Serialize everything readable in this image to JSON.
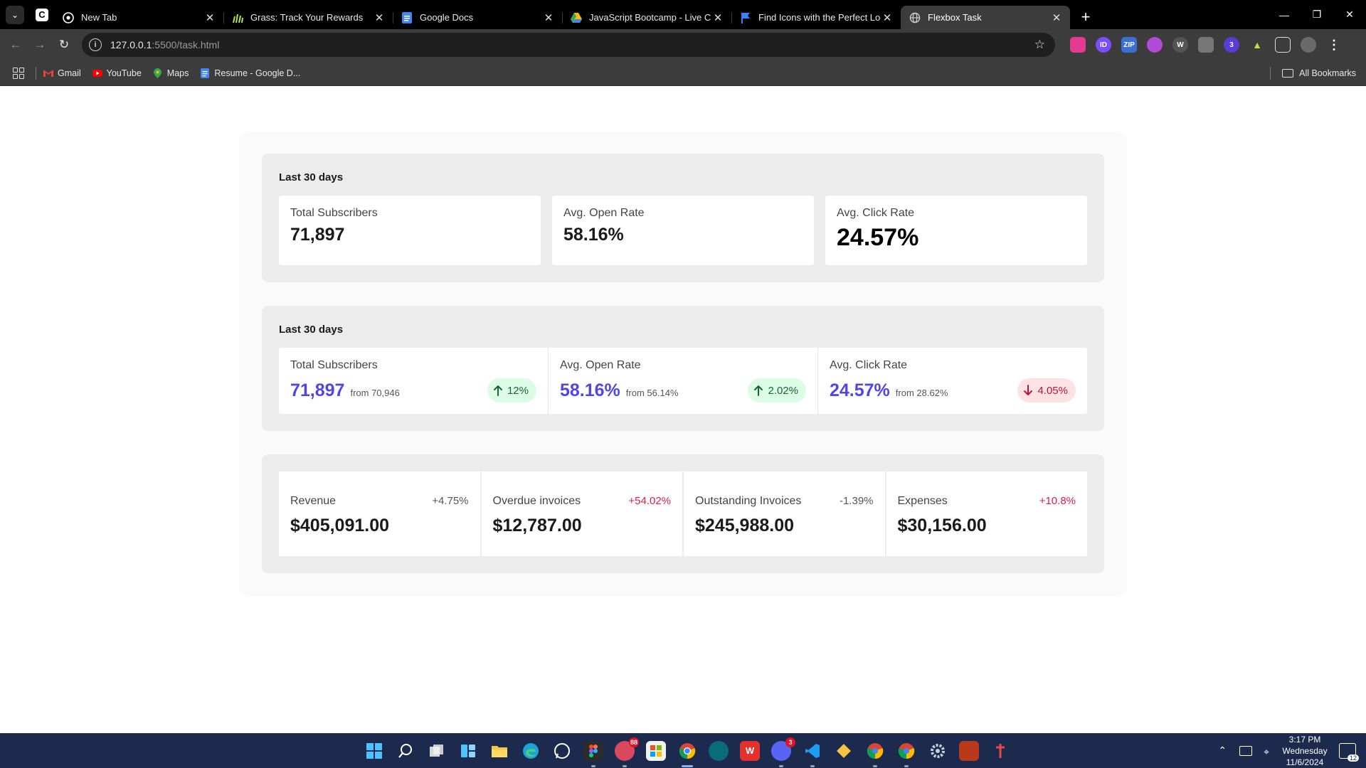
{
  "browser": {
    "tabs": [
      {
        "title": "New Tab",
        "icon": "chrome-icon",
        "active": false
      },
      {
        "title": "Grass: Track Your Rewards",
        "icon": "grass-icon",
        "active": false
      },
      {
        "title": "Google Docs",
        "icon": "google-docs-icon",
        "active": false
      },
      {
        "title": "JavaScript Bootcamp - Live Clas",
        "icon": "google-drive-icon",
        "active": false
      },
      {
        "title": "Find Icons with the Perfect Look",
        "icon": "flag-icon",
        "active": false
      },
      {
        "title": "Flexbox Task",
        "icon": "globe-icon",
        "active": true
      }
    ],
    "url_host": "127.0.0.1",
    "url_rest": ":5500/task.html",
    "bookmarks": [
      {
        "label": "Gmail",
        "icon": "gmail-icon"
      },
      {
        "label": "YouTube",
        "icon": "youtube-icon"
      },
      {
        "label": "Maps",
        "icon": "maps-icon"
      },
      {
        "label": "Resume - Google D...",
        "icon": "google-docs-icon"
      }
    ],
    "all_bookmarks": "All Bookmarks"
  },
  "section1": {
    "title": "Last 30 days",
    "cards": [
      {
        "label": "Total Subscribers",
        "value": "71,897"
      },
      {
        "label": "Avg. Open Rate",
        "value": "58.16%"
      },
      {
        "label": "Avg. Click Rate",
        "value": "24.57%"
      }
    ]
  },
  "section2": {
    "title": "Last 30 days",
    "cards": [
      {
        "label": "Total Subscribers",
        "value": "71,897",
        "from": "from 70,946",
        "change": "12%",
        "direction": "up"
      },
      {
        "label": "Avg. Open Rate",
        "value": "58.16%",
        "from": "from 56.14%",
        "change": "2.02%",
        "direction": "up"
      },
      {
        "label": "Avg. Click Rate",
        "value": "24.57%",
        "from": "from 28.62%",
        "change": "4.05%",
        "direction": "down"
      }
    ]
  },
  "section3": {
    "cards": [
      {
        "label": "Revenue",
        "change": "+4.75%",
        "value": "$405,091.00"
      },
      {
        "label": "Overdue invoices",
        "change": "+54.02%",
        "value": "$12,787.00"
      },
      {
        "label": "Outstanding Invoices",
        "change": "-1.39%",
        "value": "$245,988.00"
      },
      {
        "label": "Expenses",
        "change": "+10.8%",
        "value": "$30,156.00"
      }
    ]
  },
  "colors": {
    "accent_value": "#4f46e5",
    "up_bg": "#dcfce7",
    "up_text": "#166534",
    "down_bg": "#fde2e4",
    "down_text": "#be123c"
  },
  "taskbar": {
    "apps": [
      "windows-start-icon",
      "search-icon",
      "task-view-icon",
      "widgets-icon",
      "file-explorer-icon",
      "edge-icon",
      "whatsapp-icon",
      "figma-icon",
      "app-icon",
      "microsoft-store-icon",
      "chrome-icon",
      "app-icon",
      "wps-icon",
      "discord-icon",
      "vscode-icon",
      "git-icon",
      "chrome-profile-icon",
      "chrome-profile-icon",
      "settings-icon",
      "app-icon",
      "app-icon"
    ],
    "badges": {
      "app_9": "88",
      "discord": "3"
    },
    "time": "3:17 PM",
    "day": "Wednesday",
    "date": "11/6/2024",
    "notifications": "12"
  }
}
